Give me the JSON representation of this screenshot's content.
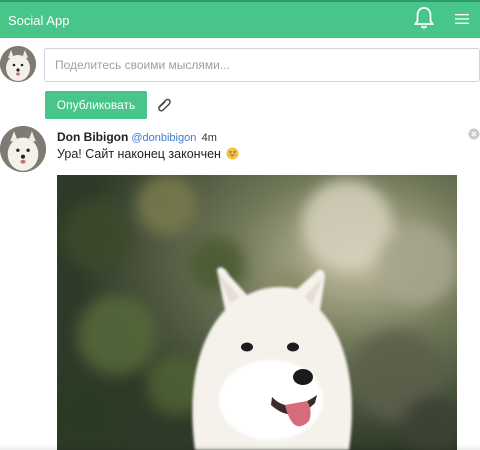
{
  "app": {
    "title": "Social App"
  },
  "header": {
    "notifications_icon": "bell-icon",
    "menu_icon": "hamburger-menu-icon"
  },
  "composer": {
    "placeholder": "Поделитесь своими мыслями...",
    "publish_label": "Опубликовать",
    "attach_icon": "paperclip-icon"
  },
  "post": {
    "author": "Don Bibigon",
    "handle": "@donbibigon",
    "time": "4m",
    "text": "Ура! Сайт наконец закончен",
    "emoji_icon": "grinning-face-icon",
    "close_icon": "close-circle-icon",
    "image_subject": "white-dog-photo"
  },
  "colors": {
    "accent": "#48c68a",
    "link": "#3a7bd5"
  }
}
